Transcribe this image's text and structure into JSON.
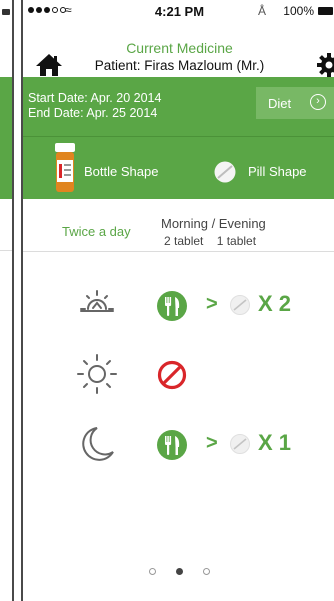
{
  "status_bar": {
    "time": "4:21 PM",
    "battery": "100%"
  },
  "header": {
    "title": "Current Medicine",
    "patient": "Patient: Firas Mazloum (Mr.)"
  },
  "medicine": {
    "start_date": "Start Date: Apr. 20 2014",
    "end_date": "End  Date: Apr. 25 2014",
    "diet_label": "Diet",
    "bottle_label": "Bottle Shape",
    "pill_label": "Pill Shape"
  },
  "frequency": {
    "label": "Twice a day",
    "times": "Morning / Evening",
    "amounts": "2 tablet    1 tablet"
  },
  "schedule": [
    {
      "time_icon": "sunrise-icon",
      "status_icon": "meal-icon",
      "arrow": ">",
      "qty": "X 2"
    },
    {
      "time_icon": "sun-icon",
      "status_icon": "no-dose-icon"
    },
    {
      "time_icon": "moon-icon",
      "status_icon": "meal-icon",
      "arrow": ">",
      "qty": "X 1"
    }
  ],
  "colors": {
    "brand": "#5aa646",
    "brand_dark": "#4b9238",
    "no_dose": "#d9262a"
  },
  "pager": {
    "pages": 3,
    "current": 2
  }
}
